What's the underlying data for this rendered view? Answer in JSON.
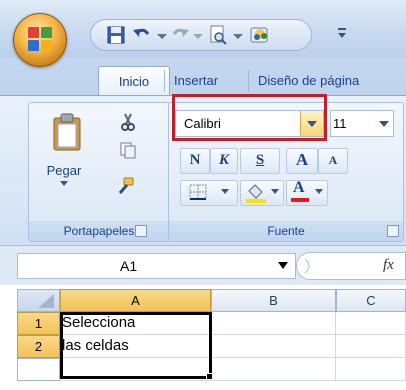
{
  "tabs": {
    "inicio": "Inicio",
    "insertar": "Insertar",
    "diseno": "Diseño de página"
  },
  "ribbon": {
    "clipboard": {
      "paste_label": "Pegar",
      "group_label": "Portapapeles"
    },
    "font": {
      "font_name": "Calibri",
      "font_size": "11",
      "bold": "N",
      "italic": "K",
      "underline": "S",
      "grow": "A",
      "shrink": "A",
      "font_color_letter": "A",
      "group_label": "Fuente"
    }
  },
  "formula_bar": {
    "name_box": "A1",
    "fx": "fx"
  },
  "grid": {
    "columns": [
      "A",
      "B",
      "C"
    ],
    "rows": [
      {
        "num": "1",
        "a": "Selecciona"
      },
      {
        "num": "2",
        "a": "las celdas"
      }
    ]
  },
  "colors": {
    "highlight_box": "#c0202a",
    "ribbon_text": "#15428b",
    "selected_header": "#f2c255"
  }
}
